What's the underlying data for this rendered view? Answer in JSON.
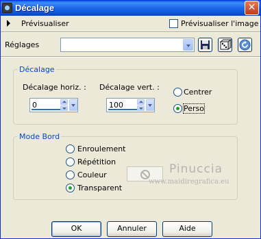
{
  "window": {
    "title": "Décalage"
  },
  "preview": {
    "label": "Prévisualiser",
    "preview_image_label": "Prévisualiser l'image",
    "preview_image_checked": false
  },
  "settings": {
    "label": "Réglages",
    "value": ""
  },
  "offset_group": {
    "title": "Décalage",
    "horizontal": {
      "label": "Décalage horiz. :",
      "value": "0"
    },
    "vertical": {
      "label": "Décalage vert. :",
      "value": "100"
    },
    "options": [
      {
        "label": "Centrer",
        "checked": false
      },
      {
        "label": "Perso",
        "checked": true
      }
    ]
  },
  "edge_group": {
    "title": "Mode Bord",
    "options": [
      {
        "label": "Enroulement",
        "checked": false
      },
      {
        "label": "Répétition",
        "checked": false
      },
      {
        "label": "Couleur",
        "checked": false
      },
      {
        "label": "Transparent",
        "checked": true
      }
    ]
  },
  "watermark": {
    "name": "Pinuccia",
    "url": "www.maidiregrafica.eu"
  },
  "buttons": {
    "ok": "OK",
    "cancel": "Annuler",
    "help": "Aide"
  },
  "icons": [
    "app-icon",
    "close-icon",
    "save-icon",
    "dice-icon",
    "reset-icon",
    "no-color-icon"
  ]
}
